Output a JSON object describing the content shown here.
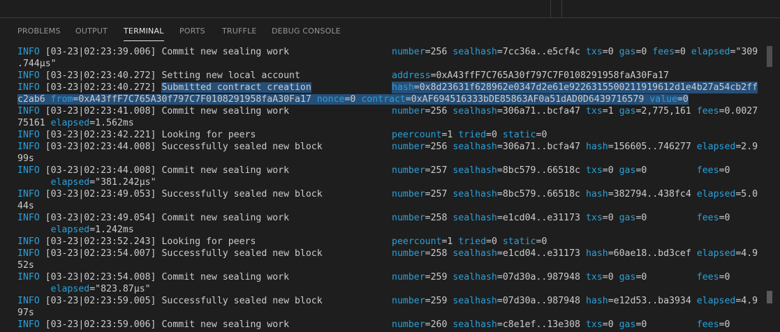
{
  "tabs": [
    {
      "label": "PROBLEMS",
      "active": false
    },
    {
      "label": "OUTPUT",
      "active": false
    },
    {
      "label": "TERMINAL",
      "active": true
    },
    {
      "label": "PORTS",
      "active": false
    },
    {
      "label": "TRUFFLE",
      "active": false
    },
    {
      "label": "DEBUG CONSOLE",
      "active": false
    }
  ],
  "colors": {
    "background": "#1e1e1e",
    "text": "#cccccc",
    "accent": "#2aa0da",
    "selection": "#264f78"
  },
  "terminal": {
    "lines": [
      {
        "lvl": "INFO",
        "ts": " [03-23|02:23:39.006] ",
        "msg": "Commit new sealing work",
        "kv": "number=256 sealhash=7cc36a..e5cf4c txs=0 gas=0 fees=0 elapsed=\"309"
      },
      {
        "cont": ".744µs\""
      },
      {
        "lvl": "INFO",
        "ts": " [03-23|02:23:40.272] ",
        "msg": "Setting new local account",
        "kv": "address=0xA43ffF7C765A30f797C7F0108291958faA30Fa17"
      },
      {
        "lvl": "INFO",
        "ts": " [03-23|02:23:40.272] ",
        "msg": "Submitted contract creation",
        "kv": "hash=0x8d23631f628962e0347d2e61e9226315500211919612d1e4b27a54cb2ff"
      },
      {
        "cont": "c2ab6 from=0xA43ffF7C765A30f797C7F0108291958faA30Fa17 nonce=0 contract=0xAF694516333bDE85863AF0a51dAD0D6439716579 value=0"
      },
      {
        "lvl": "INFO",
        "ts": " [03-23|02:23:41.008] ",
        "msg": "Commit new sealing work",
        "kv": "number=256 sealhash=306a71..bcfa47 txs=1 gas=2,775,161 fees=0.0027"
      },
      {
        "cont": "75161 elapsed=1.562ms"
      },
      {
        "lvl": "INFO",
        "ts": " [03-23|02:23:42.221] ",
        "msg": "Looking for peers",
        "kv": "peercount=1 tried=0 static=0"
      },
      {
        "lvl": "INFO",
        "ts": " [03-23|02:23:44.008] ",
        "msg": "Successfully sealed new block",
        "kv": "number=256 sealhash=306a71..bcfa47 hash=156605..746277 elapsed=2.9"
      },
      {
        "cont": "99s"
      },
      {
        "lvl": "INFO",
        "ts": " [03-23|02:23:44.008] ",
        "msg": "Commit new sealing work",
        "kv": "number=257 sealhash=8bc579..66518c txs=0 gas=0         fees=0"
      },
      {
        "cont": "      elapsed=\"381.242µs\""
      },
      {
        "lvl": "INFO",
        "ts": " [03-23|02:23:49.053] ",
        "msg": "Successfully sealed new block",
        "kv": "number=257 sealhash=8bc579..66518c hash=382794..438fc4 elapsed=5.0"
      },
      {
        "cont": "44s"
      },
      {
        "lvl": "INFO",
        "ts": " [03-23|02:23:49.054] ",
        "msg": "Commit new sealing work",
        "kv": "number=258 sealhash=e1cd04..e31173 txs=0 gas=0         fees=0"
      },
      {
        "cont": "      elapsed=1.242ms"
      },
      {
        "lvl": "INFO",
        "ts": " [03-23|02:23:52.243] ",
        "msg": "Looking for peers",
        "kv": "peercount=1 tried=0 static=0"
      },
      {
        "lvl": "INFO",
        "ts": " [03-23|02:23:54.007] ",
        "msg": "Successfully sealed new block",
        "kv": "number=258 sealhash=e1cd04..e31173 hash=60ae18..bd3cef elapsed=4.9"
      },
      {
        "cont": "52s"
      },
      {
        "lvl": "INFO",
        "ts": " [03-23|02:23:54.008] ",
        "msg": "Commit new sealing work",
        "kv": "number=259 sealhash=07d30a..987948 txs=0 gas=0         fees=0"
      },
      {
        "cont": "      elapsed=\"823.87µs\""
      },
      {
        "lvl": "INFO",
        "ts": " [03-23|02:23:59.005] ",
        "msg": "Successfully sealed new block",
        "kv": "number=259 sealhash=07d30a..987948 hash=e12d53..ba3934 elapsed=4.9"
      },
      {
        "cont": "97s"
      },
      {
        "lvl": "INFO",
        "ts": " [03-23|02:23:59.006] ",
        "msg": "Commit new sealing work",
        "kv": "number=260 sealhash=c8e1ef..13e308 txs=0 gas=0         fees=0"
      }
    ]
  }
}
